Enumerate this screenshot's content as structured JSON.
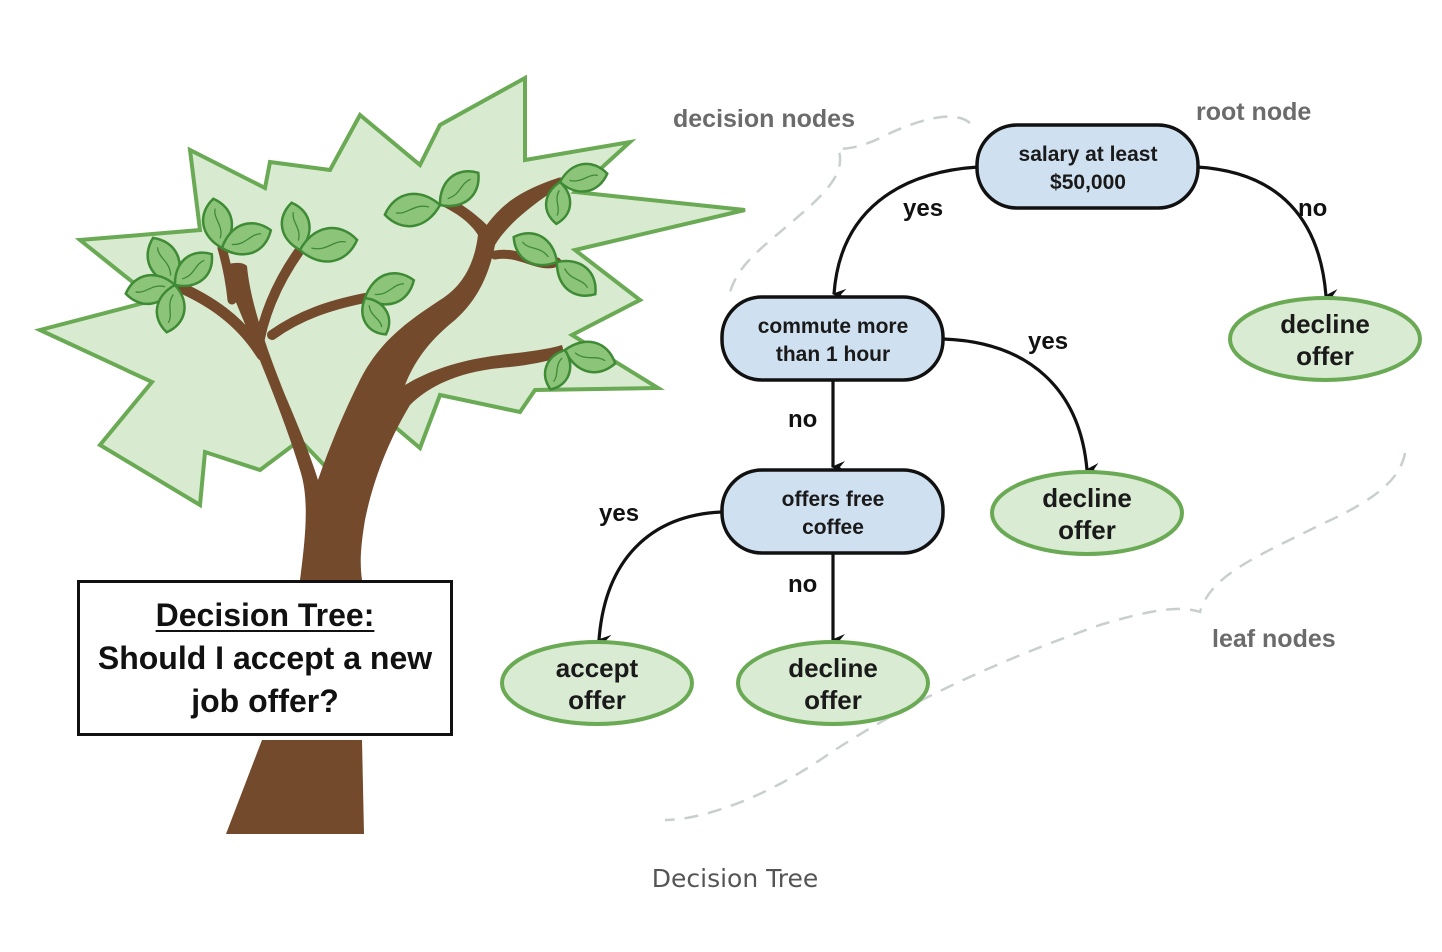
{
  "caption": "Decision Tree",
  "sign": {
    "title": "Decision Tree:",
    "line2": "Should I accept a new",
    "line3": "job offer?"
  },
  "annotations": {
    "decision_nodes": "decision nodes",
    "root_node": "root node",
    "leaf_nodes": "leaf nodes"
  },
  "decision_nodes": [
    {
      "id": "salary",
      "line1": "salary at least",
      "line2": "$50,000"
    },
    {
      "id": "commute",
      "line1": "commute more",
      "line2": "than 1 hour"
    },
    {
      "id": "coffee",
      "line1": "offers free",
      "line2": "coffee"
    }
  ],
  "leaf_nodes": [
    {
      "id": "leaf-root-no",
      "line1": "decline",
      "line2": "offer"
    },
    {
      "id": "leaf-commute-yes",
      "line1": "decline",
      "line2": "offer"
    },
    {
      "id": "leaf-coffee-yes",
      "line1": "accept",
      "line2": "offer"
    },
    {
      "id": "leaf-coffee-no",
      "line1": "decline",
      "line2": "offer"
    }
  ],
  "edges": [
    {
      "from": "salary",
      "to": "commute",
      "label": "yes"
    },
    {
      "from": "salary",
      "to": "leaf-root-no",
      "label": "no"
    },
    {
      "from": "commute",
      "to": "leaf-commute-yes",
      "label": "yes"
    },
    {
      "from": "commute",
      "to": "coffee",
      "label": "no"
    },
    {
      "from": "coffee",
      "to": "leaf-coffee-yes",
      "label": "yes"
    },
    {
      "from": "coffee",
      "to": "leaf-coffee-no",
      "label": "no"
    }
  ],
  "colors": {
    "decision_fill": "#cfe0f0",
    "leaf_fill": "#d9ebd2",
    "leaf_stroke": "#6aaa55",
    "trunk": "#744a2c",
    "canopy_fill": "#d8ebd0",
    "canopy_stroke": "#6aaa55",
    "leaf_green": "#8cc47a",
    "leaf_outline": "#3f8a35"
  }
}
